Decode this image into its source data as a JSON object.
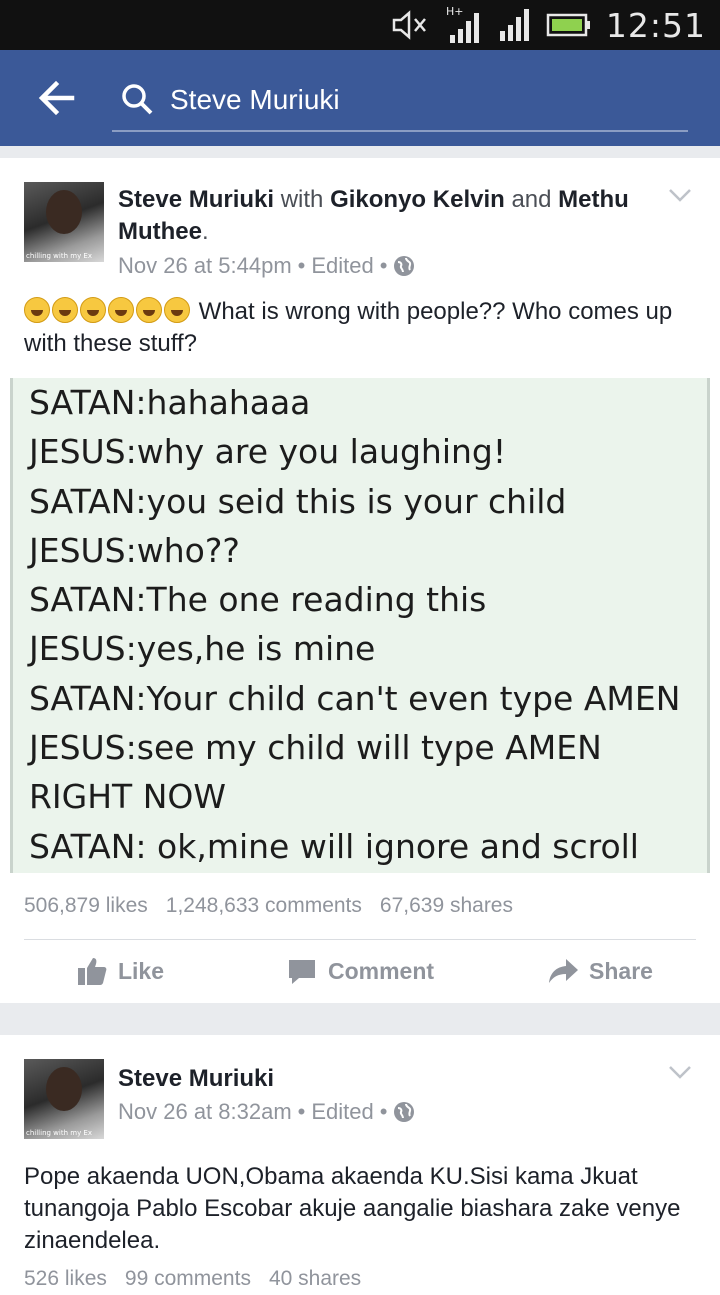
{
  "status_bar": {
    "time": "12:51",
    "network_label": "H+"
  },
  "app_bar": {
    "search_value": "Steve Muriuki"
  },
  "post1": {
    "author": "Steve Muriuki",
    "with_word": "with",
    "tag1": "Gikonyo Kelvin",
    "and_word": "and",
    "tag2": "Methu Muthee",
    "period": ".",
    "date": "Nov 26 at 5:44pm",
    "sep1": "•",
    "edited": "Edited",
    "sep2": "•",
    "avatar_caption": "chilling with my Ex",
    "text": "What is wrong with people?? Who comes up with these stuff?",
    "image_lines": [
      "SATAN:hahahaaa",
      "JESUS:why are you laughing!",
      "SATAN:you seid this is your child",
      "JESUS:who??",
      "SATAN:The one reading this",
      "JESUS:yes,he is mine",
      "SATAN:Your child can't even type AMEN",
      "JESUS:see my child will type AMEN",
      "RIGHT NOW",
      "SATAN: ok,mine will ignore and scroll"
    ],
    "likes": "506,879 likes",
    "comments": "1,248,633 comments",
    "shares": "67,639 shares"
  },
  "actions": {
    "like": "Like",
    "comment": "Comment",
    "share": "Share"
  },
  "post2": {
    "author": "Steve Muriuki",
    "date": "Nov 26 at 8:32am",
    "sep1": "•",
    "edited": "Edited",
    "sep2": "•",
    "avatar_caption": "chilling with my Ex",
    "text": "Pope akaenda UON,Obama akaenda KU.Sisi kama Jkuat tunangoja Pablo Escobar akuje aangalie biashara zake venye zinaendelea.",
    "likes": "526 likes",
    "comments": "99 comments",
    "shares": "40 shares"
  },
  "colors": {
    "brand": "#3b5998",
    "meta_gray": "#90949c"
  }
}
